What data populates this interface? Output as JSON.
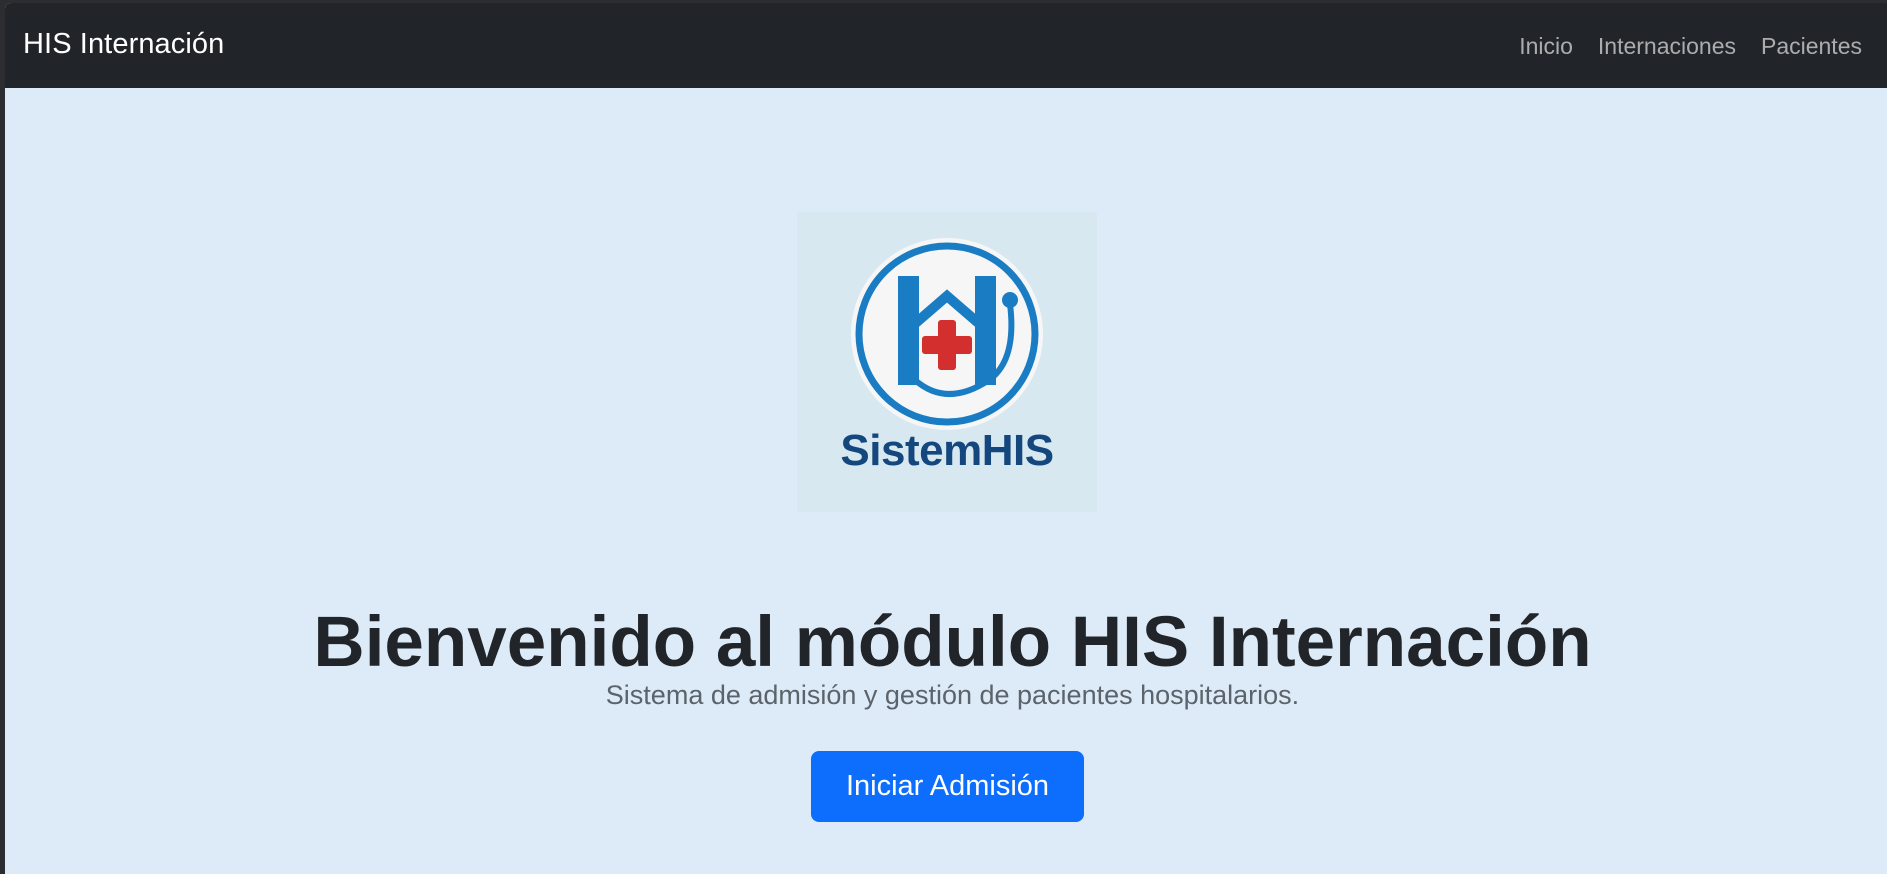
{
  "navbar": {
    "brand": "HIS Internación",
    "links": [
      {
        "label": "Inicio"
      },
      {
        "label": "Internaciones"
      },
      {
        "label": "Pacientes"
      }
    ]
  },
  "logo": {
    "text": "SistemHIS",
    "colors": {
      "primary_blue": "#1a7dc4",
      "dark_blue": "#13477e",
      "red_cross": "#d32f2f",
      "circle_bg": "#f5f5f5"
    }
  },
  "hero": {
    "title": "Bienvenido al módulo HIS Internación",
    "subtitle": "Sistema de admisión y gestión de pacientes hospitalarios.",
    "cta_label": "Iniciar Admisión"
  },
  "theme": {
    "navbar_bg": "#212529",
    "page_bg": "#dcebf7",
    "button_bg": "#0d6efd"
  }
}
